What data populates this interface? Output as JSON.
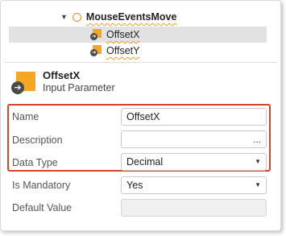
{
  "tree": {
    "root_label": "MouseEventsMove",
    "children": [
      {
        "label": "OffsetX",
        "selected": true
      },
      {
        "label": "OffsetY",
        "selected": false
      }
    ]
  },
  "header": {
    "title": "OffsetX",
    "subtitle": "Input Parameter"
  },
  "properties": {
    "name": {
      "label": "Name",
      "value": "OffsetX"
    },
    "description": {
      "label": "Description",
      "value": "",
      "button": "..."
    },
    "data_type": {
      "label": "Data Type",
      "value": "Decimal"
    },
    "is_mandatory": {
      "label": "Is Mandatory",
      "value": "Yes"
    },
    "default_value": {
      "label": "Default Value",
      "value": ""
    }
  },
  "colors": {
    "highlight": "#d2452b",
    "parameter_icon": "#f5a623",
    "action_icon": "#f08a24"
  }
}
